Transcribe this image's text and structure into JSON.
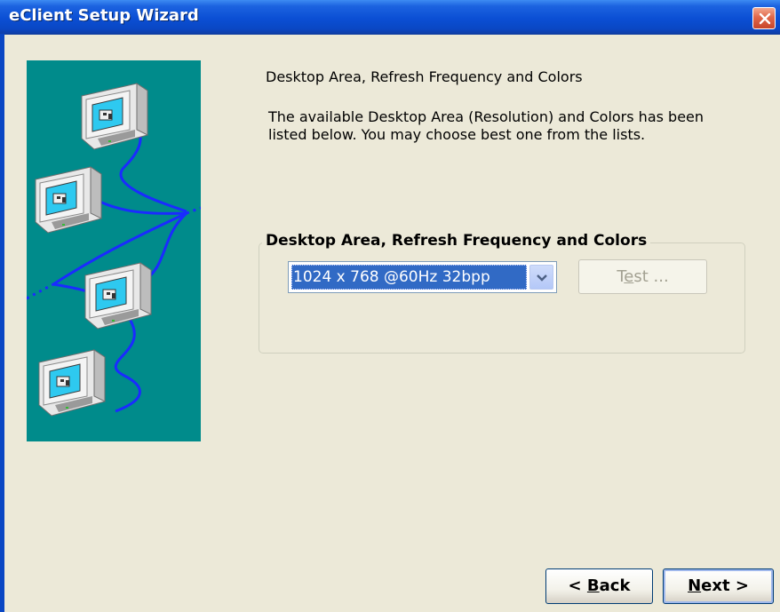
{
  "window": {
    "title": "eClient Setup Wizard",
    "close_icon": "close-icon"
  },
  "illustration": {
    "icon": "networked-computers-icon",
    "background": "#008b8b"
  },
  "page": {
    "heading": "Desktop Area, Refresh Frequency and Colors",
    "description": "The available Desktop Area (Resolution) and Colors has been listed below. You may choose best one from the lists."
  },
  "group": {
    "label": "Desktop Area, Refresh Frequency and Colors",
    "mode_select": {
      "value": "1024 x 768 @60Hz 32bpp",
      "icon": "chevron-down-icon"
    },
    "test_button": {
      "label_pre": "T",
      "label_mnemonic": "e",
      "label_post": "st ...",
      "enabled": false
    }
  },
  "buttons": {
    "back": {
      "label_pre": "< ",
      "label_mnemonic": "B",
      "label_post": "ack"
    },
    "next": {
      "label_pre": "",
      "label_mnemonic": "N",
      "label_post": "ext >"
    }
  },
  "colors": {
    "titlebar": "#0a47c4",
    "dialog_bg": "#ece9d8",
    "selection": "#316ac5"
  }
}
